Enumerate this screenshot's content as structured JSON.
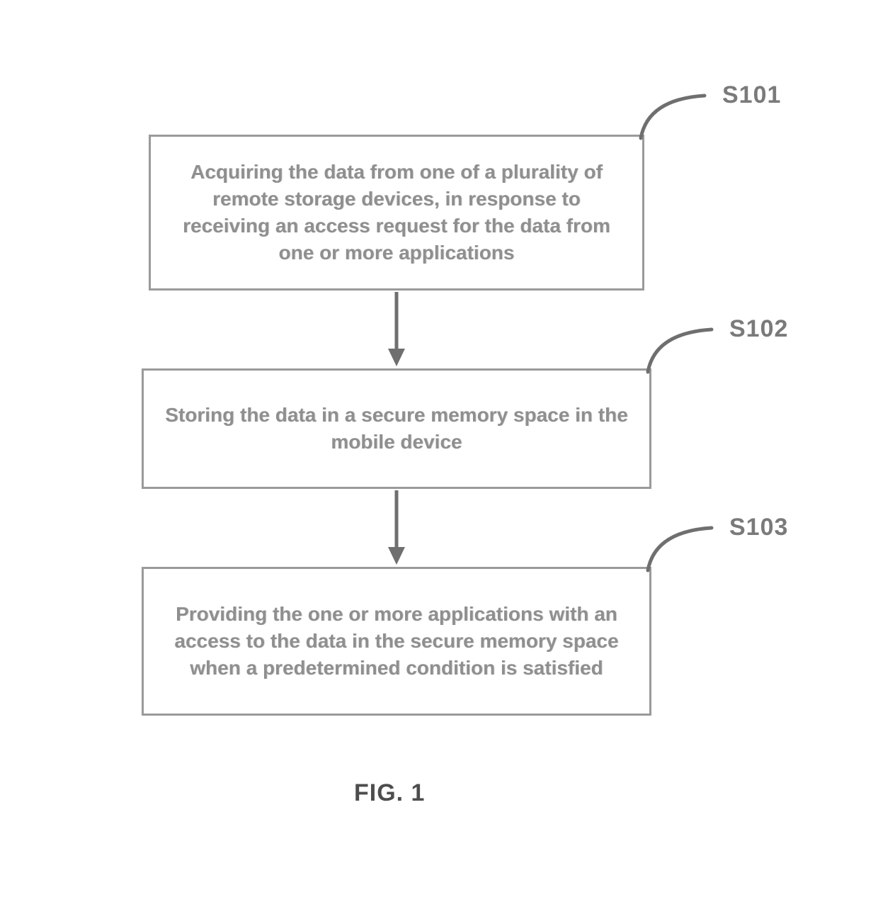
{
  "steps": [
    {
      "label": "S101",
      "text": "Acquiring the data from one of a plurality of remote storage devices, in response to receiving an access request for the data from one or more applications"
    },
    {
      "label": "S102",
      "text": "Storing the data in a secure memory space in the mobile device"
    },
    {
      "label": "S103",
      "text": "Providing the one or more applications with an access to the data in the secure memory space when a predetermined condition is satisfied"
    }
  ],
  "caption": "FIG. 1"
}
